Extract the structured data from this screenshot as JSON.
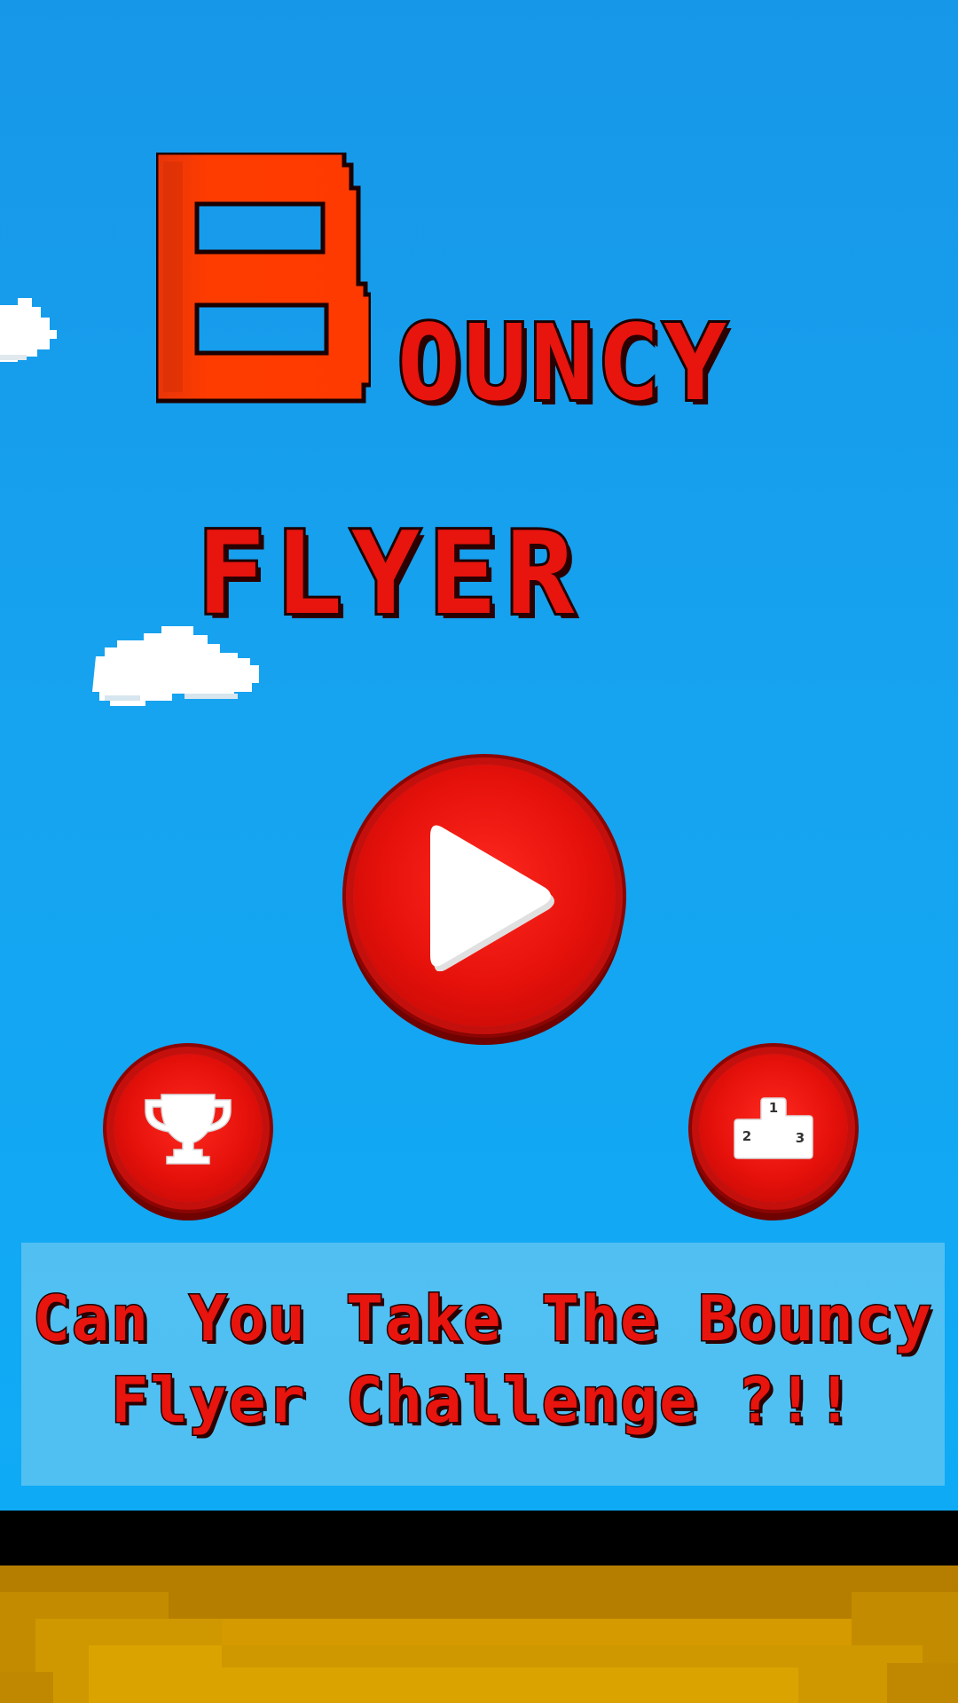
{
  "title": {
    "first_letter": "B",
    "rest_word1": "OUNCY",
    "word2": "FLYER"
  },
  "buttons": {
    "play_icon": "play-icon",
    "achievements_icon": "trophy-icon",
    "leaderboard_icon": "podium-icon",
    "podium_ranks": [
      "1",
      "2",
      "3"
    ]
  },
  "banner": {
    "line1": "Can You Take The Bouncy",
    "line2": "Flyer Challenge ?!!"
  },
  "colors": {
    "sky": "#16a4f0",
    "title_red": "#e8140e",
    "button_red": "#e4100a",
    "ground": "#d29a00"
  }
}
